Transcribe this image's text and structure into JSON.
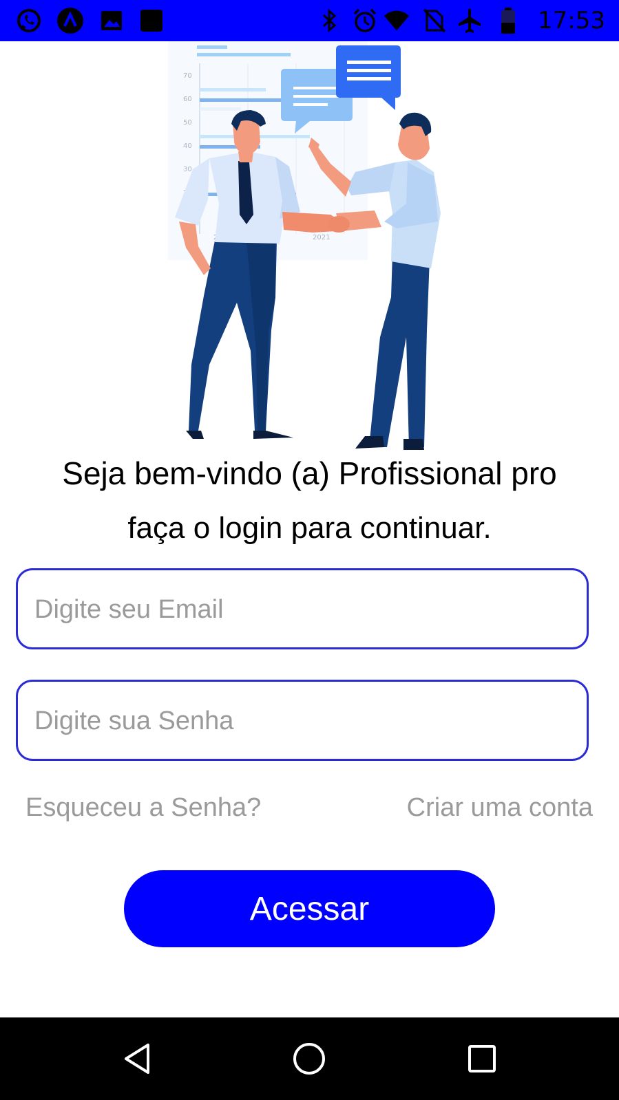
{
  "status_bar": {
    "time": "17:53",
    "left_icons": [
      "whatsapp-icon",
      "react-app-icon",
      "gallery-icon",
      "app-square-icon"
    ],
    "right_icons": [
      "bluetooth-icon",
      "alarm-icon",
      "wifi-icon",
      "no-sim-icon",
      "airplane-mode-icon",
      "battery-icon"
    ]
  },
  "illustration": {
    "y_ticks": [
      "70",
      "60",
      "50",
      "40",
      "30",
      "2"
    ],
    "x_ticks": [
      "2019",
      "2021"
    ]
  },
  "login": {
    "welcome_text": "Seja bem-vindo (a) Profissional pro",
    "subtitle_text": "faça o login para continuar.",
    "email_placeholder": "Digite seu Email",
    "password_placeholder": "Digite sua Senha",
    "forgot_password": "Esqueceu a Senha?",
    "create_account": "Criar uma conta",
    "submit_label": "Acessar"
  },
  "nav_bar": {
    "buttons": [
      "back-icon",
      "home-icon",
      "recents-icon"
    ]
  },
  "colors": {
    "accent": "#0000ff",
    "field_border": "#2b2bd6",
    "muted_text": "#9a9a9a"
  }
}
